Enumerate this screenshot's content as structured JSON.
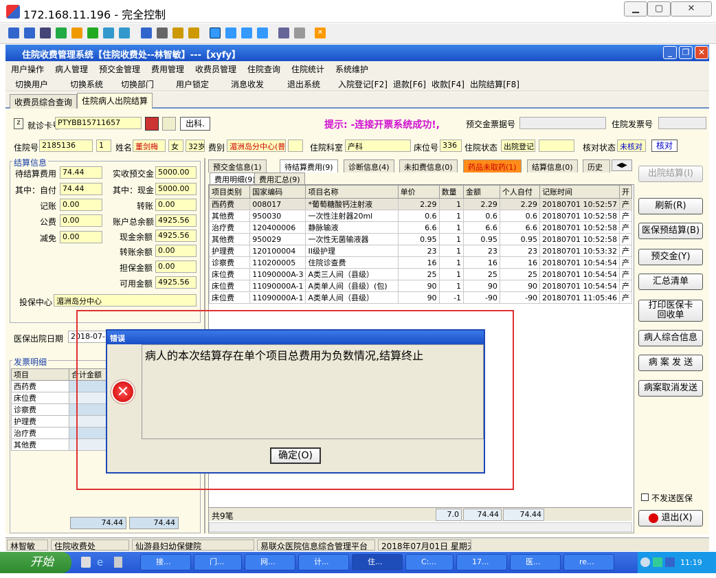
{
  "rdp": {
    "title": "172.168.11.196 - 完全控制"
  },
  "app": {
    "title": "住院收费管理系统【住院收费处--林智敏】---【xyfy】"
  },
  "menu": [
    "用户操作",
    "病人管理",
    "预交金管理",
    "费用管理",
    "收费员管理",
    "住院查询",
    "住院统计",
    "系统维护"
  ],
  "toolbar": [
    "切换用户",
    "切换系统",
    "切换部门",
    "用户锁定",
    "消息收发",
    "退出系统",
    "入院登记[F2]",
    "退款[F6]",
    "收款[F4]",
    "出院结算[F8]"
  ],
  "tabs": [
    "收费员综合查询",
    "住院病人出院结算"
  ],
  "header": {
    "card_label": "就诊卡号",
    "card_value": "PTYBB15711657",
    "discharge_btn": "出科.",
    "hint": "提示: -连接开票系统成功!,",
    "prepay_label": "预交金票据号",
    "inv_label": "住院发票号",
    "inpatient_no_label": "住院号",
    "inpatient_no": "2185136",
    "times": "1",
    "name_label": "姓名",
    "name": "董剑梅",
    "gender": "女",
    "age": "32岁",
    "fee_type_label": "费别",
    "fee_type": "湄洲岛分中心(普",
    "dept_label": "住院科室",
    "dept": "产科",
    "bed_label": "床位号",
    "bed": "336",
    "status_label": "住院状态",
    "status": "出院登记",
    "check_label": "核对状态",
    "check_status": "未核对",
    "check_btn": "核对"
  },
  "settle": {
    "title": "结算信息",
    "items_left": [
      [
        "待结算费用",
        "74.44"
      ],
      [
        "其中：自付",
        "74.44"
      ],
      [
        "记账",
        "0.00"
      ],
      [
        "公费",
        "0.00"
      ],
      [
        "减免",
        "0.00"
      ]
    ],
    "items_right": [
      [
        "实收预交金",
        "5000.00"
      ],
      [
        "其中：现金",
        "5000.00"
      ],
      [
        "转账",
        "0.00"
      ],
      [
        "账户总余额",
        "4925.56"
      ],
      [
        "现金余额",
        "4925.56"
      ],
      [
        "转账余额",
        "0.00"
      ],
      [
        "担保金额",
        "0.00"
      ],
      [
        "可用金额",
        "4925.56"
      ]
    ],
    "insurance_label": "投保中心",
    "insurance": "湄洲岛分中心",
    "discharge_date_label": "医保出院日期",
    "discharge_date": "2018-07-"
  },
  "invoice": {
    "title": "发票明细",
    "headers": [
      "项目",
      "合计金额"
    ],
    "rows": [
      "西药费",
      "床位费",
      "诊察费",
      "护理费",
      "治疗费",
      "其他费"
    ],
    "total1": "74.44",
    "total2": "74.44"
  },
  "right_tabs": [
    "预交金信息(1)",
    "待结算费用(9)",
    "诊断信息(4)",
    "未扣费信息(0)",
    "药品未取药(1)",
    "结算信息(0)",
    "历史"
  ],
  "sub_tabs": [
    "费用明细(9)",
    "费用汇总(9)"
  ],
  "grid": {
    "headers": [
      "项目类别",
      "国家编码",
      "项目名称",
      "单价",
      "数量",
      "金额",
      "个人自付",
      "记账时间",
      "开"
    ],
    "rows": [
      [
        "西药费",
        "008017",
        "*葡萄糖酸钙注射液",
        "2.29",
        "1",
        "2.29",
        "2.29",
        "20180701 10:52:57",
        "产"
      ],
      [
        "其他费",
        "950030",
        "一次性注射器20ml",
        "0.6",
        "1",
        "0.6",
        "0.6",
        "20180701 10:52:58",
        "产"
      ],
      [
        "治疗费",
        "120400006",
        "静脉输液",
        "6.6",
        "1",
        "6.6",
        "6.6",
        "20180701 10:52:58",
        "产"
      ],
      [
        "其他费",
        "950029",
        "一次性无菌输液器",
        "0.95",
        "1",
        "0.95",
        "0.95",
        "20180701 10:52:58",
        "产"
      ],
      [
        "护理费",
        "120100004",
        "II级护理",
        "23",
        "1",
        "23",
        "23",
        "20180701 10:53:32",
        "产"
      ],
      [
        "诊察费",
        "110200005",
        "住院诊查费",
        "16",
        "1",
        "16",
        "16",
        "20180701 10:54:54",
        "产"
      ],
      [
        "床位费",
        "11090000A-3",
        "A类三人间（县级）",
        "25",
        "1",
        "25",
        "25",
        "20180701 10:54:54",
        "产"
      ],
      [
        "床位费",
        "11090000A-1",
        "A类单人间（县级）(包)",
        "90",
        "1",
        "90",
        "90",
        "20180701 10:54:54",
        "产"
      ],
      [
        "床位费",
        "11090000A-1",
        "A类单人间（县级）",
        "90",
        "-1",
        "-90",
        "-90",
        "20180701 11:05:46",
        "产"
      ]
    ],
    "footer_count": "共9笔",
    "footer_qty": "7.0",
    "footer_amt": "74.44",
    "footer_self": "74.44"
  },
  "buttons": [
    "出院结算(I)",
    "刷新(R)",
    "医保预结算(B)",
    "预交金(Y)",
    "汇总清单",
    "打印医保卡\n回收单",
    "病人综合信息",
    "病 案 发 送",
    "病案取消发送"
  ],
  "no_send": "不发送医保",
  "exit_btn": "退出(X)",
  "statusbar": [
    "林智敏",
    "住院收费处",
    "仙游县妇幼保健院",
    "易联众医院信息综合管理平台",
    "2018年07月01日 星期天"
  ],
  "taskbar": {
    "start": "开始",
    "tasks": [
      "接...",
      "门...",
      "网...",
      "计...",
      "住...",
      "C:...",
      "17...",
      "医...",
      "re..."
    ],
    "time": "11:19"
  },
  "dialog": {
    "title": "错误",
    "message": "病人的本次结算存在单个项目总费用为负数情况,结算终止",
    "ok": "确定(O)"
  }
}
